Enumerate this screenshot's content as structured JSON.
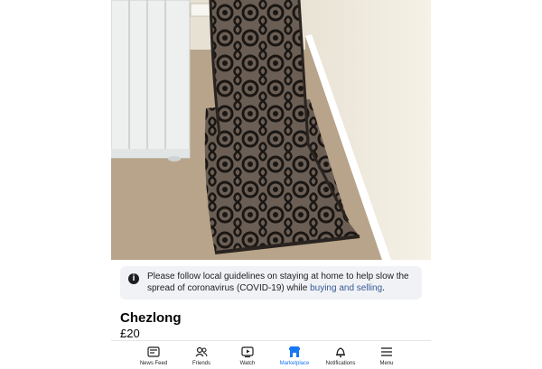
{
  "listing": {
    "title": "Chezlong",
    "price": "£20"
  },
  "notice": {
    "text": "Please follow local guidelines on staying at home to help slow the spread of coronavirus (COVID-19) while ",
    "link": "buying and selling",
    "suffix": "."
  },
  "tabbar": {
    "tabs": [
      {
        "label": "News Feed",
        "icon": "news-feed-icon"
      },
      {
        "label": "Friends",
        "icon": "friends-icon"
      },
      {
        "label": "Watch",
        "icon": "watch-icon"
      },
      {
        "label": "Marketplace",
        "icon": "marketplace-icon",
        "active": true
      },
      {
        "label": "Notifications",
        "icon": "bell-icon"
      },
      {
        "label": "Menu",
        "icon": "menu-icon"
      }
    ]
  },
  "colors": {
    "active_tab": "#1877f2",
    "link": "#385898",
    "notice_bg": "#f0f2f5"
  }
}
